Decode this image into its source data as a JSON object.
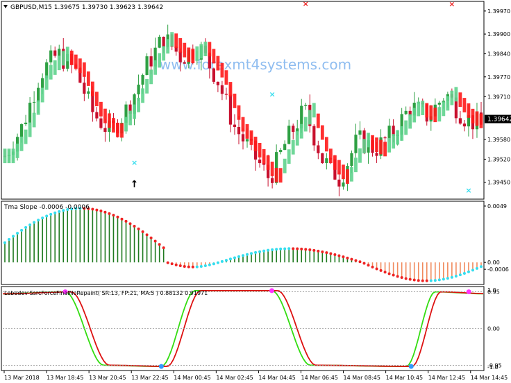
{
  "symbol_header": "GBPUSD,M15  1.39675 1.39730 1.39623 1.39642",
  "watermark": "www.forexmt4systems.com",
  "colors": {
    "bull_candle": "#2ea043",
    "bear_candle": "#c8102e",
    "tma_up": "#5fd38d",
    "tma_down": "#ff1a1a",
    "slope_pos": "#1f7a1f",
    "slope_neg": "#f08a5d",
    "dot_cyan": "#33ddee",
    "dot_red": "#ee2222",
    "fisher_green": "#33dd11",
    "fisher_red": "#dd1111",
    "signal_blue": "#3399ff",
    "signal_magenta": "#ff33ff",
    "price_tag_bg": "#000000",
    "price_tag_text": "#ffffff",
    "watermark": "#8fbdf0"
  },
  "chart_data": [
    {
      "type": "candlestick",
      "title": "GBPUSD,M15",
      "ohlc_header": {
        "open": 1.39675,
        "high": 1.3973,
        "low": 1.39623,
        "close": 1.39642
      },
      "current_price_label": "1.39642",
      "current_price": 1.39642,
      "ylim": [
        1.39405,
        1.39995
      ],
      "yticks": [
        "1.39970",
        "1.39900",
        "1.39840",
        "1.39770",
        "1.39710",
        "1.39642",
        "1.39580",
        "1.39520",
        "1.39450"
      ],
      "ytick_values": [
        1.3997,
        1.399,
        1.3984,
        1.3977,
        1.3971,
        1.39642,
        1.3958,
        1.3952,
        1.3945
      ],
      "xticks": [
        "13 Mar 2018",
        "13 Mar 18:45",
        "13 Mar 20:45",
        "13 Mar 22:45",
        "14 Mar 00:45",
        "14 Mar 02:45",
        "14 Mar 04:45",
        "14 Mar 06:45",
        "14 Mar 08:45",
        "14 Mar 10:45",
        "14 Mar 12:45",
        "14 Mar 14:45"
      ],
      "close_path": [
        1.3953,
        1.3962,
        1.3978,
        1.3984,
        1.3979,
        1.3966,
        1.396,
        1.3968,
        1.398,
        1.3989,
        1.3983,
        1.3986,
        1.3977,
        1.3962,
        1.3954,
        1.3946,
        1.3958,
        1.3967,
        1.3952,
        1.3946,
        1.3958,
        1.3955,
        1.396,
        1.3968,
        1.3965,
        1.3972,
        1.3965,
        1.3962
      ],
      "markers": [
        {
          "label": "×",
          "color": "red",
          "bar": 72,
          "price": 1.39985
        },
        {
          "label": "×",
          "color": "red",
          "bar": 107,
          "price": 1.39983
        },
        {
          "label": "×",
          "color": "cyan",
          "bar": 64,
          "price": 1.3971
        },
        {
          "label": "×",
          "color": "cyan",
          "bar": 31,
          "price": 1.39502
        },
        {
          "label": "×",
          "color": "cyan",
          "bar": 111,
          "price": 1.39418
        },
        {
          "label": "↑",
          "color": "black",
          "bar": 31,
          "price": 1.39435
        }
      ]
    },
    {
      "type": "bar",
      "title": "Tma Slope -0.0006 -0.0006",
      "ylim": [
        -0.0018,
        0.0052
      ],
      "yticks": [
        "0.0049",
        "0.00",
        "-0.0006"
      ],
      "ytick_values": [
        0.0049,
        0.0,
        -0.0006
      ],
      "description_note": "oscillating histogram: positive green bars first half, small positive hump mid, negative orange bars at end"
    },
    {
      "type": "line",
      "title": "Lebedev-SsrcForceFinalNoRepaint( SR:13, FP:21, MA:5 ) 0.88132 0.91971",
      "ylim": [
        -1.05,
        1.05
      ],
      "yticks": [
        "0.95",
        "1.0",
        "0.00",
        "-0.95",
        "-1.0"
      ],
      "ytick_values": [
        0.95,
        1.0,
        0.0,
        -0.95,
        -1.0
      ],
      "series": [
        {
          "name": "",
          "color": "green"
        },
        {
          "name": "",
          "color": "red"
        }
      ]
    }
  ]
}
